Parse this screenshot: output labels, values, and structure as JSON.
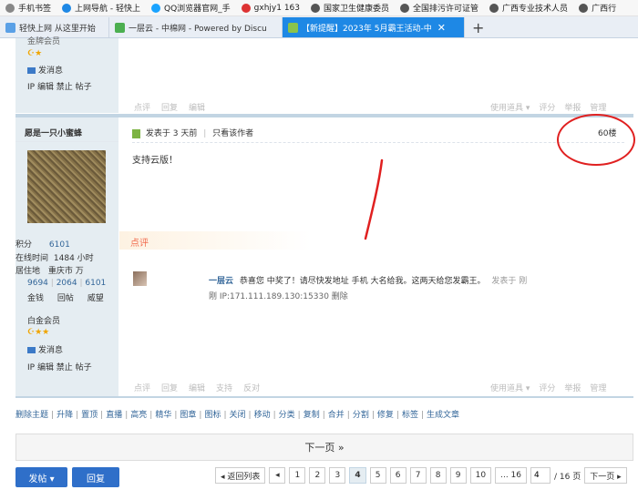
{
  "bookmarks": [
    {
      "label": "手机书签",
      "icon": "bookmark-icon",
      "color": "#888"
    },
    {
      "label": "上网导航 - 轻快上",
      "icon": "browser-e-icon",
      "color": "#1e88e5"
    },
    {
      "label": "QQ浏览器官网_手",
      "icon": "qq-browser-icon",
      "color": "#1aa3ff"
    },
    {
      "label": "gxhjy1 163",
      "icon": "163-mail-icon",
      "color": "#d33"
    },
    {
      "label": "国家卫生健康委员",
      "icon": "globe-icon",
      "color": "#555"
    },
    {
      "label": "全国排污许可证管",
      "icon": "globe-icon",
      "color": "#555"
    },
    {
      "label": "广西专业技术人员",
      "icon": "globe-icon",
      "color": "#555"
    },
    {
      "label": "广西行",
      "icon": "globe-icon",
      "color": "#555"
    }
  ],
  "tabs": [
    {
      "label": "轻快上网 从这里开始",
      "icon": "page-icon",
      "active": false
    },
    {
      "label": "一层云 - 中棉网 - Powered by Discu",
      "icon": "discuz-icon",
      "active": false
    },
    {
      "label": "【新提醒】2023年 5月霸王活动-中",
      "icon": "discuz-icon",
      "active": true
    }
  ],
  "newtab_label": "+",
  "post1": {
    "group": "金牌会员",
    "stars": "☪★",
    "send_msg": "发消息",
    "ip_links": "IP 编辑 禁止 帖子",
    "actions": [
      "点评",
      "回复",
      "编辑"
    ],
    "right_actions": [
      "使用道具 ▾",
      "评分",
      "举报",
      "管理"
    ]
  },
  "post2": {
    "author": "愿是一只小蜜蜂",
    "posted": "发表于 3 天前",
    "only_author": "只看该作者",
    "floor": "60楼",
    "content": "支持云版！",
    "stats": {
      "points_label": "积分",
      "points": "6101",
      "online_label": "在线时间",
      "online": "1484 小时",
      "location_label": "居住地",
      "location": "重庆市 万",
      "counts": [
        "9694",
        "2064",
        "6101"
      ],
      "count_labels": [
        "金钱",
        "回帖",
        "威望"
      ]
    },
    "group": "白金会员",
    "stars": "☪★★",
    "send_msg": "发消息",
    "ip_links": "IP 编辑 禁止 帖子",
    "comment_heading": "点评",
    "comment": {
      "user": "一层云",
      "text": "恭喜您 中奖了！请尽快发地址 手机 大名给我。这两天给您发霸王。",
      "time": "发表于 刚",
      "meta": "刚 IP:171.111.189.130:15330 删除"
    },
    "actions": [
      "点评",
      "回复",
      "编辑",
      "支持",
      "反对"
    ],
    "right_actions": [
      "使用道具 ▾",
      "评分",
      "举报",
      "管理"
    ]
  },
  "admin_links": [
    "删除主题",
    "升降",
    "置顶",
    "直播",
    "高亮",
    "精华",
    "图章",
    "图标",
    "关闭",
    "移动",
    "分类",
    "复制",
    "合并",
    "分割",
    "修复",
    "标签",
    "生成文章"
  ],
  "next_page": "下一页  »",
  "post_button": "发帖 ▾",
  "reply_button": "回复",
  "pager": {
    "back": "◂ 返回列表",
    "prev": "◂",
    "pages": [
      "1",
      "2",
      "3",
      "4",
      "5",
      "6",
      "7",
      "8",
      "9",
      "10"
    ],
    "current": "4",
    "ellipsis": "... 16",
    "input_value": "4",
    "total": "/ 16 页",
    "next": "下一页 ▸"
  },
  "colors": {
    "accent": "#2f6fc9",
    "sidebar": "#e5edf2",
    "annotation_red": "#e02020",
    "active_tab": "#1e88e5"
  }
}
